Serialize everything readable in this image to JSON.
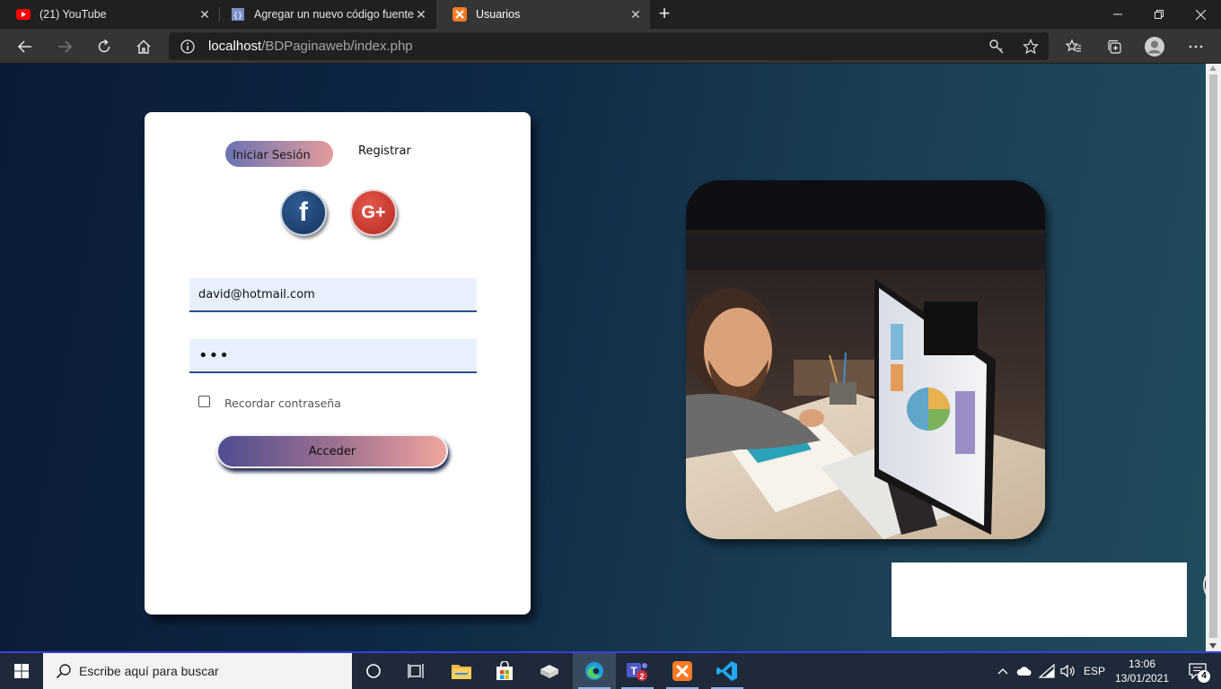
{
  "browser": {
    "tabs": [
      {
        "title": "(21) YouTube",
        "favicon": "youtube-icon",
        "active": false
      },
      {
        "title": "Agregar un nuevo código fuente",
        "favicon": "code-page-icon",
        "active": false
      },
      {
        "title": "Usuarios",
        "favicon": "xampp-icon",
        "active": true
      }
    ],
    "url_host": "localhost",
    "url_path": "/BDPaginaweb/index.php"
  },
  "login": {
    "tab_login": "Iniciar Sesión",
    "tab_register": "Registrar",
    "facebook_letter": "f",
    "google_letter": "G+",
    "email_value": "david@hotmail.com",
    "password_value": "•••",
    "remember_label": "Recordar contraseña",
    "submit_label": "Acceder"
  },
  "taskbar": {
    "search_placeholder": "Escribe aquí para buscar",
    "language": "ESP",
    "time": "13:06",
    "date": "13/01/2021",
    "teams_badge": "2",
    "notifications_count": "4"
  },
  "colors": {
    "accent_gradient_start": "#4f4d91",
    "accent_gradient_end": "#f0a49e",
    "page_bg_start": "#0b1a38",
    "page_bg_end": "#204c5c"
  }
}
